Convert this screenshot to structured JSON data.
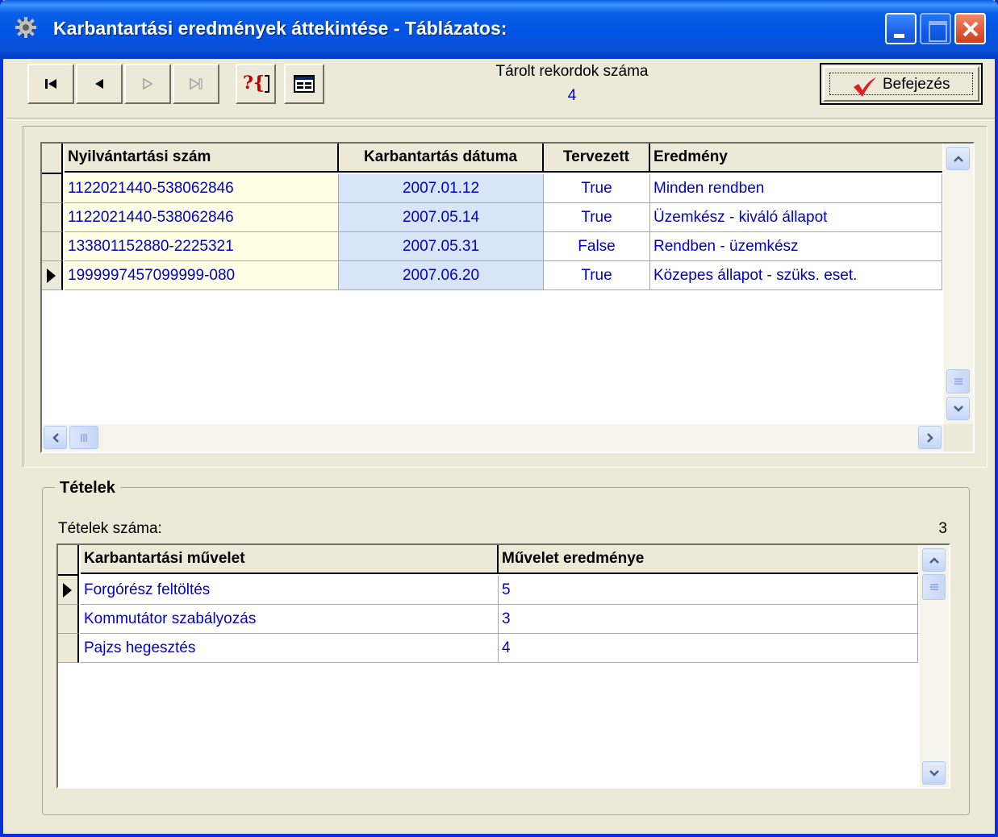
{
  "window": {
    "title": "Karbantartási eredmények áttekintése - Táblázatos:"
  },
  "toolbar": {
    "records_label": "Tárolt rekordok száma",
    "records_count": "4",
    "finish_label": "Befejezés",
    "help_glyph": "?{"
  },
  "main_grid": {
    "columns": [
      "Nyilvántartási szám",
      "Karbantartás dátuma",
      "Tervezett",
      "Eredmény"
    ],
    "rows": [
      {
        "id": "1122021440-538062846",
        "date": "2007.01.12",
        "planned": "True",
        "result": "Minden rendben"
      },
      {
        "id": "1122021440-538062846",
        "date": "2007.05.14",
        "planned": "True",
        "result": "Üzemkész - kiváló állapot"
      },
      {
        "id": "133801152880-2225321",
        "date": "2007.05.31",
        "planned": "False",
        "result": "Rendben - üzemkész"
      },
      {
        "id": "1999997457099999-080",
        "date": "2007.06.20",
        "planned": "True",
        "result": "Közepes állapot - szüks. eset."
      }
    ],
    "current_row": 3
  },
  "items": {
    "group_title": "Tételek",
    "count_label": "Tételek száma:",
    "count_value": "3",
    "columns": [
      "Karbantartási művelet",
      "Művelet eredménye"
    ],
    "rows": [
      {
        "operation": "Forgórész feltöltés",
        "result": "5"
      },
      {
        "operation": "Kommutátor szabályozás",
        "result": "3"
      },
      {
        "operation": "Pajzs hegesztés",
        "result": "4"
      }
    ],
    "current_row": 0
  },
  "colors": {
    "titlebar": "#0054e3",
    "data_text": "#0000cc",
    "id_column_bg": "#ffffe6",
    "date_column_bg": "#d8e4f8",
    "check_mark": "#e02020"
  },
  "icons": [
    "gear-icon",
    "first-record-icon",
    "prev-record-icon",
    "next-record-icon",
    "last-record-icon",
    "help-icon",
    "grid-view-icon",
    "checkmark-icon"
  ]
}
